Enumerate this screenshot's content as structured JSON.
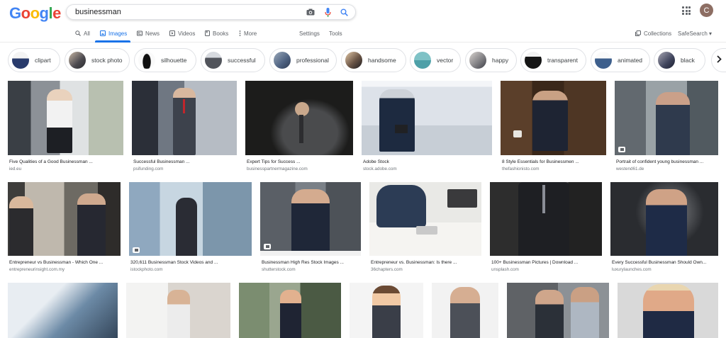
{
  "logo": {
    "letters": [
      "G",
      "o",
      "o",
      "g",
      "l",
      "e"
    ],
    "colors": [
      "#4285f4",
      "#ea4335",
      "#fbbc05",
      "#4285f4",
      "#34a853",
      "#ea4335"
    ]
  },
  "search": {
    "query": "businessman",
    "icons": [
      "camera-icon",
      "microphone-icon",
      "search-icon"
    ]
  },
  "account": {
    "initial": "C",
    "avatar_color": "#8d6e63"
  },
  "tabs": {
    "all": "All",
    "images": "Images",
    "news": "News",
    "videos": "Videos",
    "books": "Books",
    "more": "More",
    "settings": "Settings",
    "tools": "Tools",
    "collections": "Collections",
    "safesearch": "SafeSearch ▾"
  },
  "chips": [
    "clipart",
    "stock photo",
    "silhouette",
    "successful",
    "professional",
    "handsome",
    "vector",
    "happy",
    "transparent",
    "animated",
    "black"
  ],
  "results": {
    "row1": [
      {
        "caption": "Five Qualities of a Good Businessman ...",
        "source": "ied.eu"
      },
      {
        "caption": "Successful Businessman ...",
        "source": "psifunding.com"
      },
      {
        "caption": "Expert Tips for Success ...",
        "source": "businesspartnermagazine.com"
      },
      {
        "caption": "Adobe Stock",
        "source": "stock.adobe.com"
      },
      {
        "caption": "8 Style Essentials for Businessmen ...",
        "source": "thefashionisto.com"
      },
      {
        "caption": "Portrait of confident young businessman ...",
        "source": "westend61.de"
      }
    ],
    "row2": [
      {
        "caption": "Entrepreneur vs Businessman - Which One ...",
        "source": "entrepreneurinsight.com.my"
      },
      {
        "caption": "320,611 Businessman Stock Videos and ...",
        "source": "istockphoto.com"
      },
      {
        "caption": "Businessman High Res Stock Images ...",
        "source": "shutterstock.com"
      },
      {
        "caption": "Entrepreneur vs. Businessman: Is there ...",
        "source": "36chapters.com"
      },
      {
        "caption": "100+ Businessman Pictures | Download ...",
        "source": "unsplash.com"
      },
      {
        "caption": "Every Successful Businessman Should Own...",
        "source": "luxurylaunches.com"
      }
    ]
  },
  "accent_color": "#1a73e8"
}
